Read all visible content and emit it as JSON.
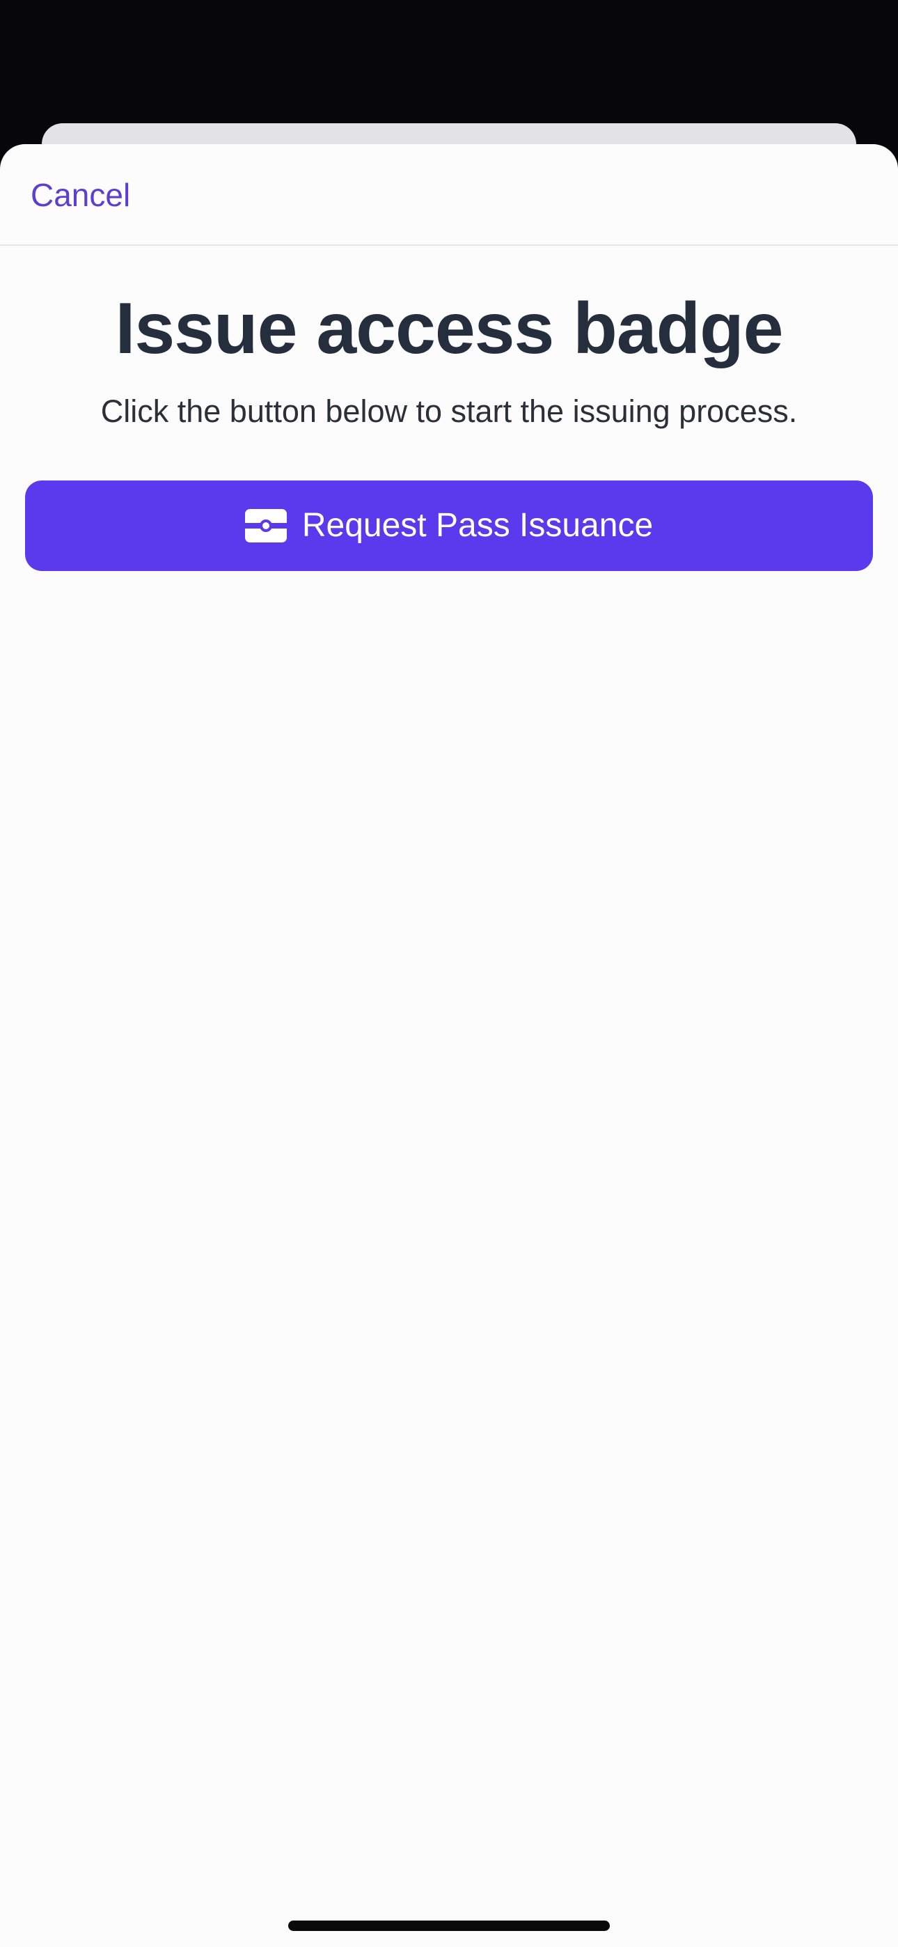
{
  "sheet": {
    "cancel_label": "Cancel",
    "title": "Issue access badge",
    "subtitle": "Click the button below to start the issuing process.",
    "primary_button": {
      "label": "Request Pass Issuance",
      "icon": "id-badge-icon"
    }
  },
  "colors": {
    "accent": "#5b3aed",
    "link": "#5b3fd1",
    "title": "#252e3c",
    "background": "#fdfcfd",
    "status_bar": "#07070b"
  }
}
